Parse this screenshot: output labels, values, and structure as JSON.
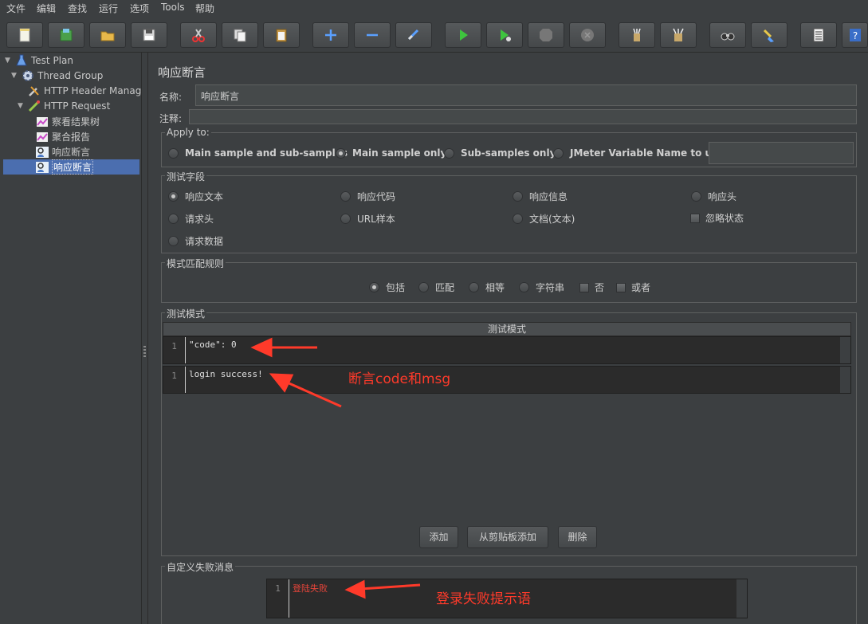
{
  "menu": [
    "文件",
    "编辑",
    "查找",
    "运行",
    "选项",
    "Tools",
    "帮助"
  ],
  "toolbar": {
    "icons": [
      "new-icon",
      "templates-icon",
      "open-icon",
      "save-icon",
      "cut-icon",
      "copy-icon",
      "paste-icon",
      "expand-icon",
      "collapse-icon",
      "toggle-icon",
      "start-icon",
      "start-no-pause-icon",
      "stop-icon",
      "shutdown-icon",
      "clear-icon",
      "clear-all-icon",
      "search-icon",
      "reset-search-icon",
      "function-helper-icon",
      "help-icon"
    ]
  },
  "tree": {
    "items": [
      {
        "label": "Test Plan",
        "icon": "flask-icon"
      },
      {
        "label": "Thread Group",
        "icon": "gear-icon"
      },
      {
        "label": "HTTP Header Manag",
        "icon": "wrench-icon"
      },
      {
        "label": "HTTP Request",
        "icon": "pipette-icon"
      },
      {
        "label": "察看结果树",
        "icon": "graph-icon"
      },
      {
        "label": "聚合报告",
        "icon": "graph-icon"
      },
      {
        "label": "响应断言",
        "icon": "assertion-icon"
      },
      {
        "label": "响应断言",
        "icon": "assertion-icon"
      }
    ]
  },
  "panel": {
    "title": "响应断言",
    "name_label": "名称:",
    "name_value": "响应断言",
    "comment_label": "注释:",
    "comment_value": ""
  },
  "apply_to": {
    "title": "Apply to:",
    "options": [
      "Main sample and sub-samples",
      "Main sample only",
      "Sub-samples only",
      "JMeter Variable Name to use"
    ],
    "selected": "Main sample only",
    "variable_value": ""
  },
  "test_field": {
    "title": "测试字段",
    "options": [
      "响应文本",
      "响应代码",
      "响应信息",
      "响应头",
      "请求头",
      "URL样本",
      "文档(文本)",
      "请求数据"
    ],
    "selected": "响应文本",
    "ignore_status_label": "忽略状态"
  },
  "match_rules": {
    "title": "模式匹配规则",
    "options": [
      "包括",
      "匹配",
      "相等",
      "字符串"
    ],
    "selected": "包括",
    "not_label": "否",
    "or_label": "或者"
  },
  "patterns": {
    "title": "测试模式",
    "column_header": "测试模式",
    "rows": [
      {
        "line": "1",
        "text": "\"code\": 0"
      },
      {
        "line": "1",
        "text": "login success!"
      }
    ],
    "add_label": "添加",
    "add_clipboard_label": "从剪贴板添加",
    "delete_label": "删除"
  },
  "failure_message": {
    "title": "自定义失败消息",
    "line": "1",
    "text": "登陆失败"
  },
  "annotations": {
    "assert_note": "断言code和msg",
    "failure_note": "登录失败提示语",
    "color": "#ff3a2a"
  },
  "colors": {
    "background": "#3c3f41",
    "selection": "#4b6eaf",
    "editor_bg": "#2b2b2b"
  }
}
